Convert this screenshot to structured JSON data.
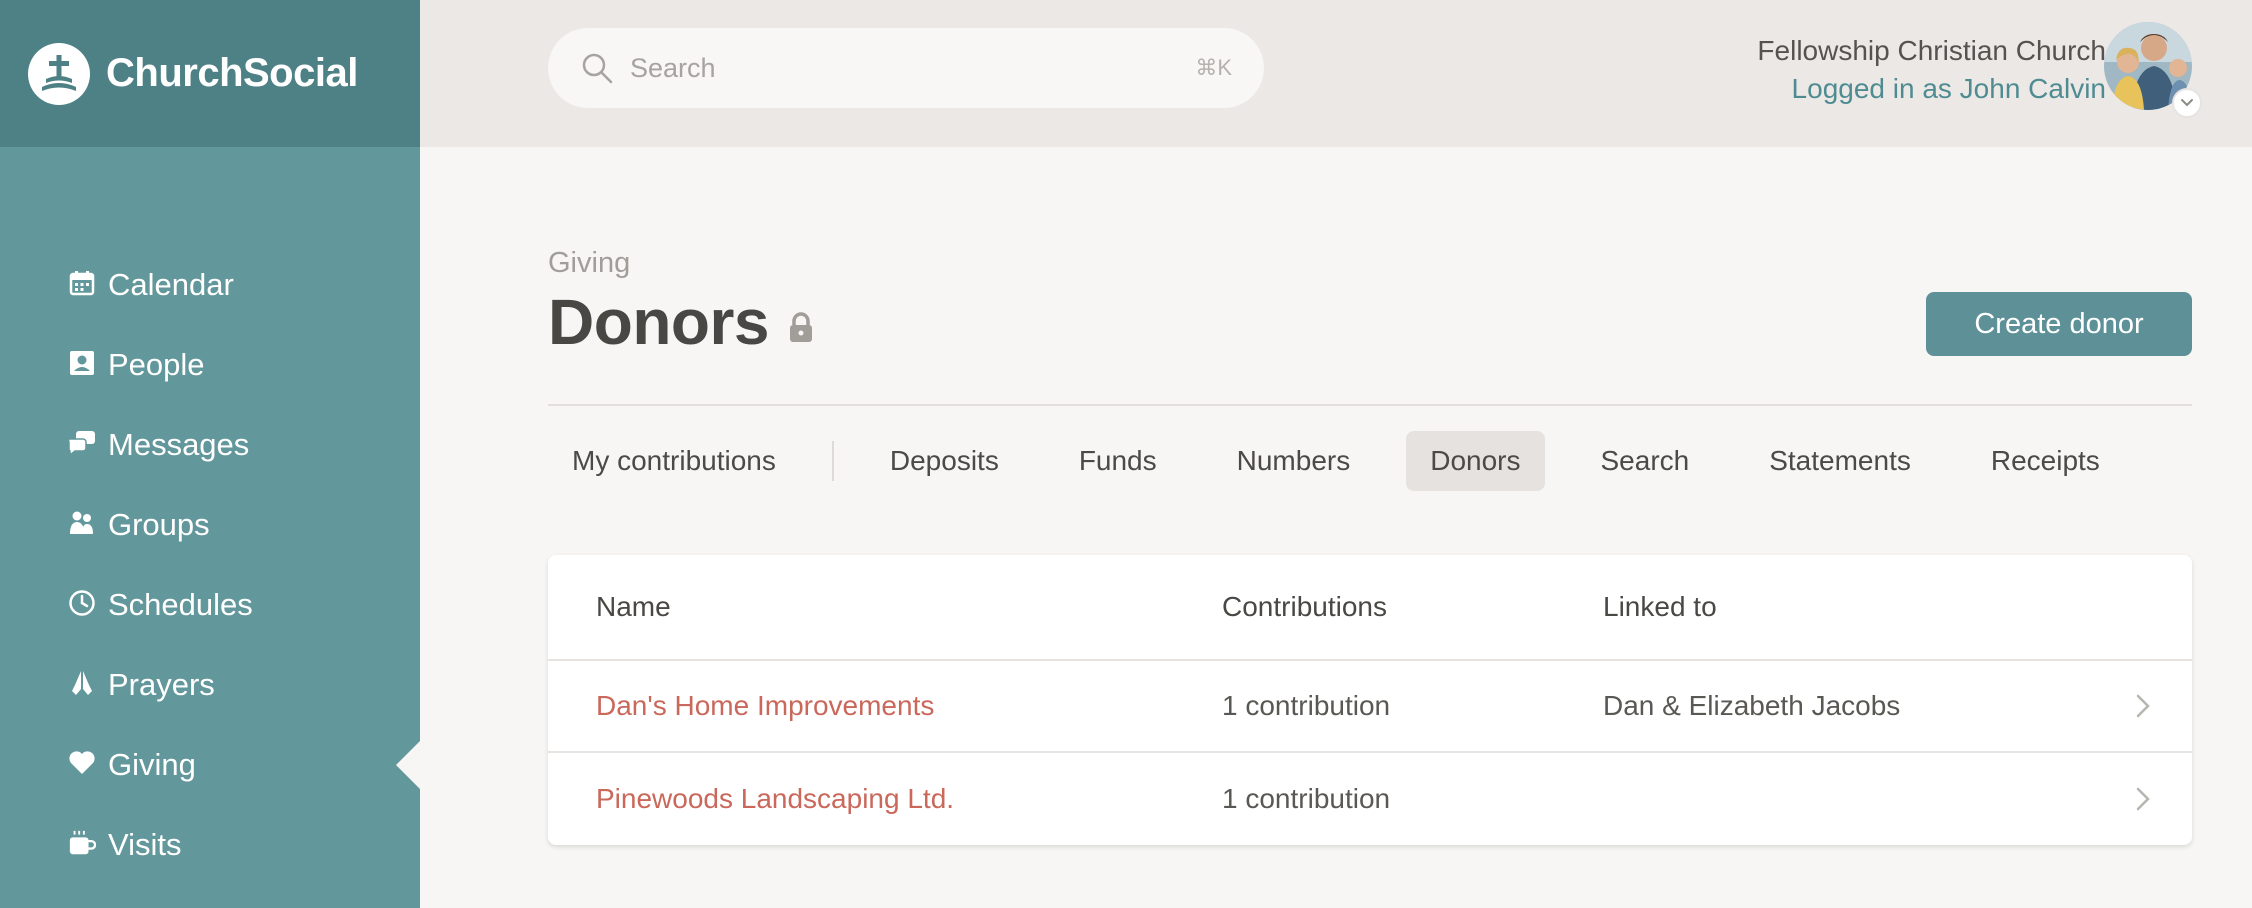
{
  "brand": {
    "name": "ChurchSocial",
    "logo_icon": "church-cross-icon"
  },
  "sidebar": {
    "items": [
      {
        "label": "Calendar",
        "icon": "calendar-icon",
        "active": false
      },
      {
        "label": "People",
        "icon": "people-icon",
        "active": false
      },
      {
        "label": "Messages",
        "icon": "messages-icon",
        "active": false
      },
      {
        "label": "Groups",
        "icon": "groups-icon",
        "active": false
      },
      {
        "label": "Schedules",
        "icon": "clock-icon",
        "active": false
      },
      {
        "label": "Prayers",
        "icon": "praying-hands-icon",
        "active": false
      },
      {
        "label": "Giving",
        "icon": "heart-icon",
        "active": true
      },
      {
        "label": "Visits",
        "icon": "coffee-cup-icon",
        "active": false
      }
    ]
  },
  "header": {
    "search": {
      "placeholder": "Search",
      "shortcut": "⌘K"
    },
    "account": {
      "church_name": "Fellowship Christian Church",
      "logged_in_text": "Logged in as John Calvin"
    }
  },
  "page": {
    "breadcrumb": "Giving",
    "title": "Donors",
    "create_button": "Create donor",
    "tabs": [
      {
        "label": "My contributions",
        "active": false
      },
      {
        "label": "Deposits",
        "active": false
      },
      {
        "label": "Funds",
        "active": false
      },
      {
        "label": "Numbers",
        "active": false
      },
      {
        "label": "Donors",
        "active": true
      },
      {
        "label": "Search",
        "active": false
      },
      {
        "label": "Statements",
        "active": false
      },
      {
        "label": "Receipts",
        "active": false
      }
    ]
  },
  "table": {
    "columns": [
      "Name",
      "Contributions",
      "Linked to"
    ],
    "rows": [
      {
        "name": "Dan's Home Improvements",
        "contributions": "1 contribution",
        "linked_to": "Dan & Elizabeth Jacobs"
      },
      {
        "name": "Pinewoods Landscaping Ltd.",
        "contributions": "1 contribution",
        "linked_to": ""
      }
    ]
  },
  "colors": {
    "sidebar": "#62979b",
    "brand_bg": "#4e8186",
    "accent": "#5d9197",
    "link": "#c9685b"
  }
}
